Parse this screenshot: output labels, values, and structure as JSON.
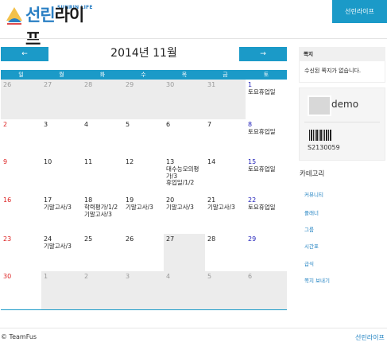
{
  "header": {
    "brand_sub": "SUNRIN LIFE",
    "brand_hl": "선린",
    "brand_rest": "라이프",
    "top_button": "선린라이프"
  },
  "calendar": {
    "title": "2014년 11월",
    "prev_icon": "arrow-left-icon",
    "next_icon": "arrow-right-icon",
    "prev_label": "←",
    "next_label": "→",
    "weekdays": [
      "일",
      "월",
      "화",
      "수",
      "목",
      "금",
      "토"
    ],
    "weeks": [
      [
        {
          "d": "26",
          "other": true,
          "events": []
        },
        {
          "d": "27",
          "other": true,
          "events": []
        },
        {
          "d": "28",
          "other": true,
          "events": []
        },
        {
          "d": "29",
          "other": true,
          "events": []
        },
        {
          "d": "30",
          "other": true,
          "events": []
        },
        {
          "d": "31",
          "other": true,
          "events": []
        },
        {
          "d": "1",
          "other": false,
          "events": [
            "토요휴업일"
          ]
        }
      ],
      [
        {
          "d": "2",
          "other": false,
          "events": []
        },
        {
          "d": "3",
          "other": false,
          "events": []
        },
        {
          "d": "4",
          "other": false,
          "events": []
        },
        {
          "d": "5",
          "other": false,
          "events": []
        },
        {
          "d": "6",
          "other": false,
          "events": []
        },
        {
          "d": "7",
          "other": false,
          "events": []
        },
        {
          "d": "8",
          "other": false,
          "events": [
            "토요휴업일"
          ]
        }
      ],
      [
        {
          "d": "9",
          "other": false,
          "events": []
        },
        {
          "d": "10",
          "other": false,
          "events": []
        },
        {
          "d": "11",
          "other": false,
          "events": []
        },
        {
          "d": "12",
          "other": false,
          "events": []
        },
        {
          "d": "13",
          "other": false,
          "events": [
            "대수능모의평",
            "가/3",
            "휴업일/1/2"
          ]
        },
        {
          "d": "14",
          "other": false,
          "events": []
        },
        {
          "d": "15",
          "other": false,
          "events": [
            "토요휴업일"
          ]
        }
      ],
      [
        {
          "d": "16",
          "other": false,
          "events": []
        },
        {
          "d": "17",
          "other": false,
          "events": [
            "기말고사/3"
          ]
        },
        {
          "d": "18",
          "other": false,
          "events": [
            "학력평가/1/2",
            "기말고사/3"
          ]
        },
        {
          "d": "19",
          "other": false,
          "events": [
            "기말고사/3"
          ]
        },
        {
          "d": "20",
          "other": false,
          "events": [
            "기말고사/3"
          ]
        },
        {
          "d": "21",
          "other": false,
          "events": [
            "기말고사/3"
          ]
        },
        {
          "d": "22",
          "other": false,
          "events": [
            "토요휴업일"
          ]
        }
      ],
      [
        {
          "d": "23",
          "other": false,
          "events": []
        },
        {
          "d": "24",
          "other": false,
          "events": [
            "기말고사/3"
          ]
        },
        {
          "d": "25",
          "other": false,
          "events": []
        },
        {
          "d": "26",
          "other": false,
          "events": []
        },
        {
          "d": "27",
          "other": false,
          "today": true,
          "events": []
        },
        {
          "d": "28",
          "other": false,
          "events": []
        },
        {
          "d": "29",
          "other": false,
          "events": []
        }
      ],
      [
        {
          "d": "30",
          "other": false,
          "events": []
        },
        {
          "d": "1",
          "other": true,
          "events": []
        },
        {
          "d": "2",
          "other": true,
          "events": []
        },
        {
          "d": "3",
          "other": true,
          "events": []
        },
        {
          "d": "4",
          "other": true,
          "events": []
        },
        {
          "d": "5",
          "other": true,
          "events": []
        },
        {
          "d": "6",
          "other": true,
          "events": []
        }
      ]
    ]
  },
  "sidebar": {
    "notes_title": "쪽지",
    "notes_empty": "수신된 쪽지가 없습니다.",
    "username": "demo",
    "student_code": "S2130059",
    "category_title": "카테고리",
    "categories": [
      "커뮤니티",
      "플래너",
      "그룹",
      "시간표",
      "급식",
      "쪽지 보내기"
    ]
  },
  "footer": {
    "copyright": "© TeamFus",
    "link": "선린라이프"
  },
  "colors": {
    "accent": "#1b9ac8",
    "sunday": "#dd2222",
    "saturday": "#2222bb",
    "shade": "#ececec"
  }
}
